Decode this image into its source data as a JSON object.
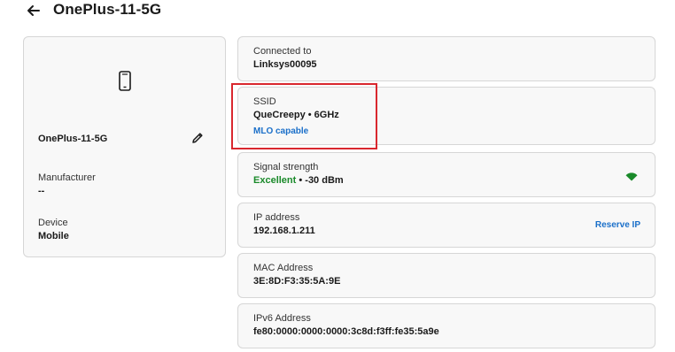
{
  "header": {
    "title": "OnePlus-11-5G",
    "back_icon": "arrow-left-icon"
  },
  "device_card": {
    "icon": "smartphone-icon",
    "name": "OnePlus-11-5G",
    "edit_icon": "pencil-icon",
    "manufacturer_label": "Manufacturer",
    "manufacturer_value": "--",
    "device_label": "Device",
    "device_value": "Mobile"
  },
  "connected": {
    "label": "Connected to",
    "value": "Linksys00095"
  },
  "ssid": {
    "label": "SSID",
    "value": "QueCreepy • 6GHz",
    "mlo_link": "MLO capable"
  },
  "signal": {
    "label": "Signal strength",
    "quality": "Excellent",
    "detail": " • -30 dBm",
    "icon": "wifi-icon",
    "quality_color": "#1a8a2a"
  },
  "ip": {
    "label": "IP address",
    "value": "192.168.1.211",
    "action": "Reserve IP"
  },
  "mac": {
    "label": "MAC Address",
    "value": "3E:8D:F3:35:5A:9E"
  },
  "ipv6": {
    "label": "IPv6 Address",
    "value": "fe80:0000:0000:0000:3c8d:f3ff:fe35:5a9e"
  },
  "colors": {
    "link": "#1a6fc9",
    "highlight": "#d9272e",
    "wifi": "#1a8a2a"
  }
}
